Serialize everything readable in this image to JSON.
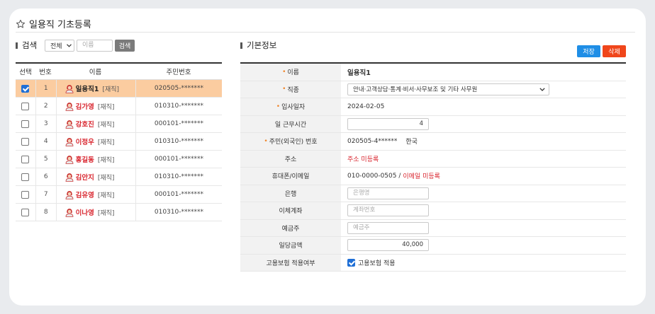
{
  "header": {
    "title": "일용직 기초등록"
  },
  "search": {
    "section_title": "검색",
    "filter_selected": "전체",
    "name_placeholder": "이름",
    "search_button": "검색"
  },
  "list": {
    "columns": {
      "select": "선택",
      "no": "번호",
      "name": "이름",
      "id": "주민번호"
    },
    "rows": [
      {
        "checked": true,
        "no": "1",
        "name": "일용직1",
        "status": "[재직]",
        "id": "020505-*******"
      },
      {
        "checked": false,
        "no": "2",
        "name": "김가영",
        "status": "[재직]",
        "id": "010310-*******"
      },
      {
        "checked": false,
        "no": "3",
        "name": "강호진",
        "status": "[재직]",
        "id": "000101-*******"
      },
      {
        "checked": false,
        "no": "4",
        "name": "이정우",
        "status": "[재직]",
        "id": "010310-*******"
      },
      {
        "checked": false,
        "no": "5",
        "name": "홍길동",
        "status": "[재직]",
        "id": "000101-*******"
      },
      {
        "checked": false,
        "no": "6",
        "name": "김안지",
        "status": "[재직]",
        "id": "010310-*******"
      },
      {
        "checked": false,
        "no": "7",
        "name": "김유영",
        "status": "[재직]",
        "id": "000101-*******"
      },
      {
        "checked": false,
        "no": "8",
        "name": "이나영",
        "status": "[재직]",
        "id": "010310-*******"
      }
    ]
  },
  "detail": {
    "section_title": "기본정보",
    "save_button": "저장",
    "delete_button": "삭제",
    "fields": {
      "name": {
        "label": "이름",
        "value": "일용직1"
      },
      "job": {
        "label": "직종",
        "value": "안내·고객상담·통계·비서·사무보조 및 기타 사무원"
      },
      "join_date": {
        "label": "입사일자",
        "value": "2024-02-05"
      },
      "work_hours": {
        "label": "일 근무시간",
        "value": "4"
      },
      "resident_no": {
        "label": "주민(외국인) 번호",
        "value": "020505-4******",
        "nationality": "한국"
      },
      "address": {
        "label": "주소",
        "value": "주소 미등록"
      },
      "phone_email": {
        "label": "휴대폰/이메일",
        "phone": "010-0000-0505 /",
        "email": "이메일 미등록"
      },
      "bank": {
        "label": "은행",
        "placeholder": "은행명"
      },
      "account": {
        "label": "이체계좌",
        "placeholder": "계좌번호"
      },
      "holder": {
        "label": "예금주",
        "placeholder": "예금주"
      },
      "daily_wage": {
        "label": "일당금액",
        "value": "40,000"
      },
      "insurance": {
        "label": "고용보험 적용여부",
        "checkbox_label": "고용보험 적용",
        "checked": true
      }
    }
  },
  "colors": {
    "accent_blue": "#1f8ee6",
    "danger": "#f0461b",
    "selected_row": "#fbcca0",
    "name_red": "#d9262f"
  },
  "icons": {
    "title": "star-icon",
    "avatar": "user-avatar-icon",
    "dropdown": "chevron-down-icon"
  }
}
